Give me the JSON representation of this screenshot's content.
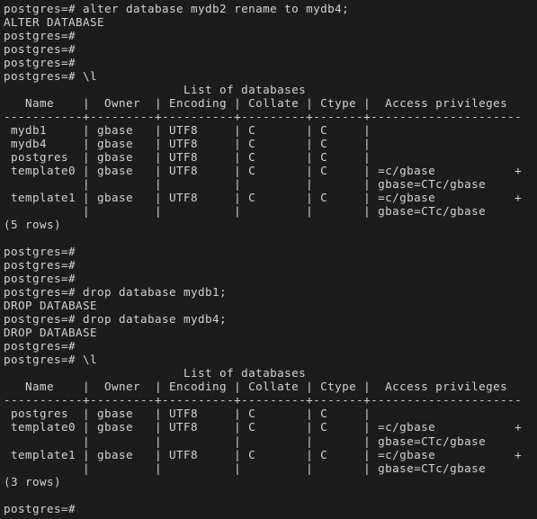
{
  "terminal": {
    "app": "psql",
    "prompt": "postgres=#",
    "colors": {
      "background": "#1c1c1c",
      "foreground": "#d6d3cc",
      "cursor": "#b9bbc9"
    },
    "cursor": {
      "visible": true,
      "shape": "block",
      "line": 38,
      "column": 12
    },
    "lines": [
      "postgres=# alter database mydb2 rename to mydb4;",
      "ALTER DATABASE",
      "postgres=#",
      "postgres=#",
      "postgres=#",
      "postgres=# \\l",
      "                         List of databases",
      "   Name    |  Owner  | Encoding | Collate | Ctype |  Access privileges",
      "-----------+---------+----------+---------+-------+---------------------",
      " mydb1     | gbase   | UTF8     | C       | C     |",
      " mydb4     | gbase   | UTF8     | C       | C     |",
      " postgres  | gbase   | UTF8     | C       | C     |",
      " template0 | gbase   | UTF8     | C       | C     | =c/gbase           +",
      "           |         |          |         |       | gbase=CTc/gbase",
      " template1 | gbase   | UTF8     | C       | C     | =c/gbase           +",
      "           |         |          |         |       | gbase=CTc/gbase",
      "(5 rows)",
      "",
      "postgres=#",
      "postgres=#",
      "postgres=#",
      "postgres=# drop database mydb1;",
      "DROP DATABASE",
      "postgres=# drop database mydb4;",
      "DROP DATABASE",
      "postgres=#",
      "postgres=# \\l",
      "                         List of databases",
      "   Name    |  Owner  | Encoding | Collate | Ctype |  Access privileges",
      "-----------+---------+----------+---------+-------+---------------------",
      " postgres  | gbase   | UTF8     | C       | C     |",
      " template0 | gbase   | UTF8     | C       | C     | =c/gbase           +",
      "           |         |          |         |       | gbase=CTc/gbase",
      " template1 | gbase   | UTF8     | C       | C     | =c/gbase           +",
      "           |         |          |         |       | gbase=CTc/gbase",
      "(3 rows)",
      "",
      "postgres=# "
    ],
    "commands": [
      "alter database mydb2 rename to mydb4;",
      "\\l",
      "drop database mydb1;",
      "drop database mydb4;",
      "\\l"
    ],
    "responses": [
      "ALTER DATABASE",
      "DROP DATABASE",
      "DROP DATABASE"
    ],
    "tables": [
      {
        "title": "List of databases",
        "columns": [
          "Name",
          "Owner",
          "Encoding",
          "Collate",
          "Ctype",
          "Access privileges"
        ],
        "rows": [
          [
            "mydb1",
            "gbase",
            "UTF8",
            "C",
            "C",
            ""
          ],
          [
            "mydb4",
            "gbase",
            "UTF8",
            "C",
            "C",
            ""
          ],
          [
            "postgres",
            "gbase",
            "UTF8",
            "C",
            "C",
            ""
          ],
          [
            "template0",
            "gbase",
            "UTF8",
            "C",
            "C",
            "=c/gbase           +\ngbase=CTc/gbase"
          ],
          [
            "template1",
            "gbase",
            "UTF8",
            "C",
            "C",
            "=c/gbase           +\ngbase=CTc/gbase"
          ]
        ],
        "row_count_label": "(5 rows)"
      },
      {
        "title": "List of databases",
        "columns": [
          "Name",
          "Owner",
          "Encoding",
          "Collate",
          "Ctype",
          "Access privileges"
        ],
        "rows": [
          [
            "postgres",
            "gbase",
            "UTF8",
            "C",
            "C",
            ""
          ],
          [
            "template0",
            "gbase",
            "UTF8",
            "C",
            "C",
            "=c/gbase           +\ngbase=CTc/gbase"
          ],
          [
            "template1",
            "gbase",
            "UTF8",
            "C",
            "C",
            "=c/gbase           +\ngbase=CTc/gbase"
          ]
        ],
        "row_count_label": "(3 rows)"
      }
    ]
  }
}
